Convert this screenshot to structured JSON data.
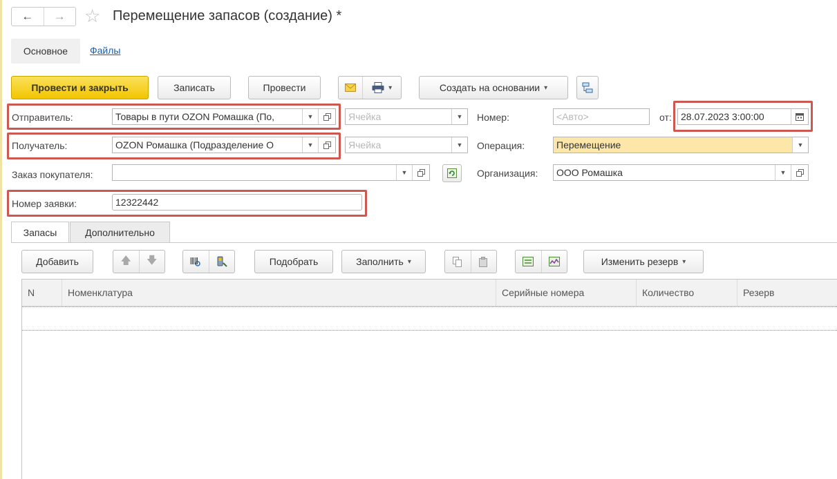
{
  "window": {
    "title": "Перемещение запасов (создание) *",
    "back_icon": "←",
    "forward_icon": "→",
    "favorite_icon": "☆"
  },
  "nav_tabs": {
    "main_label": "Основное",
    "files_label": "Файлы"
  },
  "toolbar": {
    "post_close_label": "Провести и закрыть",
    "save_label": "Записать",
    "post_label": "Провести",
    "create_based_label": "Создать на основании"
  },
  "form": {
    "sender": {
      "label": "Отправитель:",
      "value": "Товары в пути OZON Ромашка (По,",
      "cell_placeholder": "Ячейка"
    },
    "receiver": {
      "label": "Получатель:",
      "value": "OZON Ромашка (Подразделение О",
      "cell_placeholder": "Ячейка"
    },
    "customer_order": {
      "label": "Заказ покупателя:",
      "value": ""
    },
    "request_number": {
      "label": "Номер заявки:",
      "value": "12322442"
    },
    "number": {
      "label": "Номер:",
      "placeholder": "<Авто>"
    },
    "date": {
      "label": "от:",
      "value": "28.07.2023  3:00:00"
    },
    "operation": {
      "label": "Операция:",
      "value": "Перемещение"
    },
    "organization": {
      "label": "Организация:",
      "value": "ООО Ромашка"
    }
  },
  "sub_tabs": {
    "stock_label": "Запасы",
    "extra_label": "Дополнительно"
  },
  "table_toolbar": {
    "add_label": "Добавить",
    "pick_label": "Подобрать",
    "fill_label": "Заполнить",
    "change_reserve_label": "Изменить резерв"
  },
  "table": {
    "columns": [
      "N",
      "Номенклатура",
      "Серийные номера",
      "Количество",
      "Резерв"
    ],
    "rows": []
  },
  "colors": {
    "primary_button": "#f2c500",
    "highlight_border": "#cc5850",
    "operation_bg": "#fde7a8",
    "link": "#1f5ea8"
  }
}
